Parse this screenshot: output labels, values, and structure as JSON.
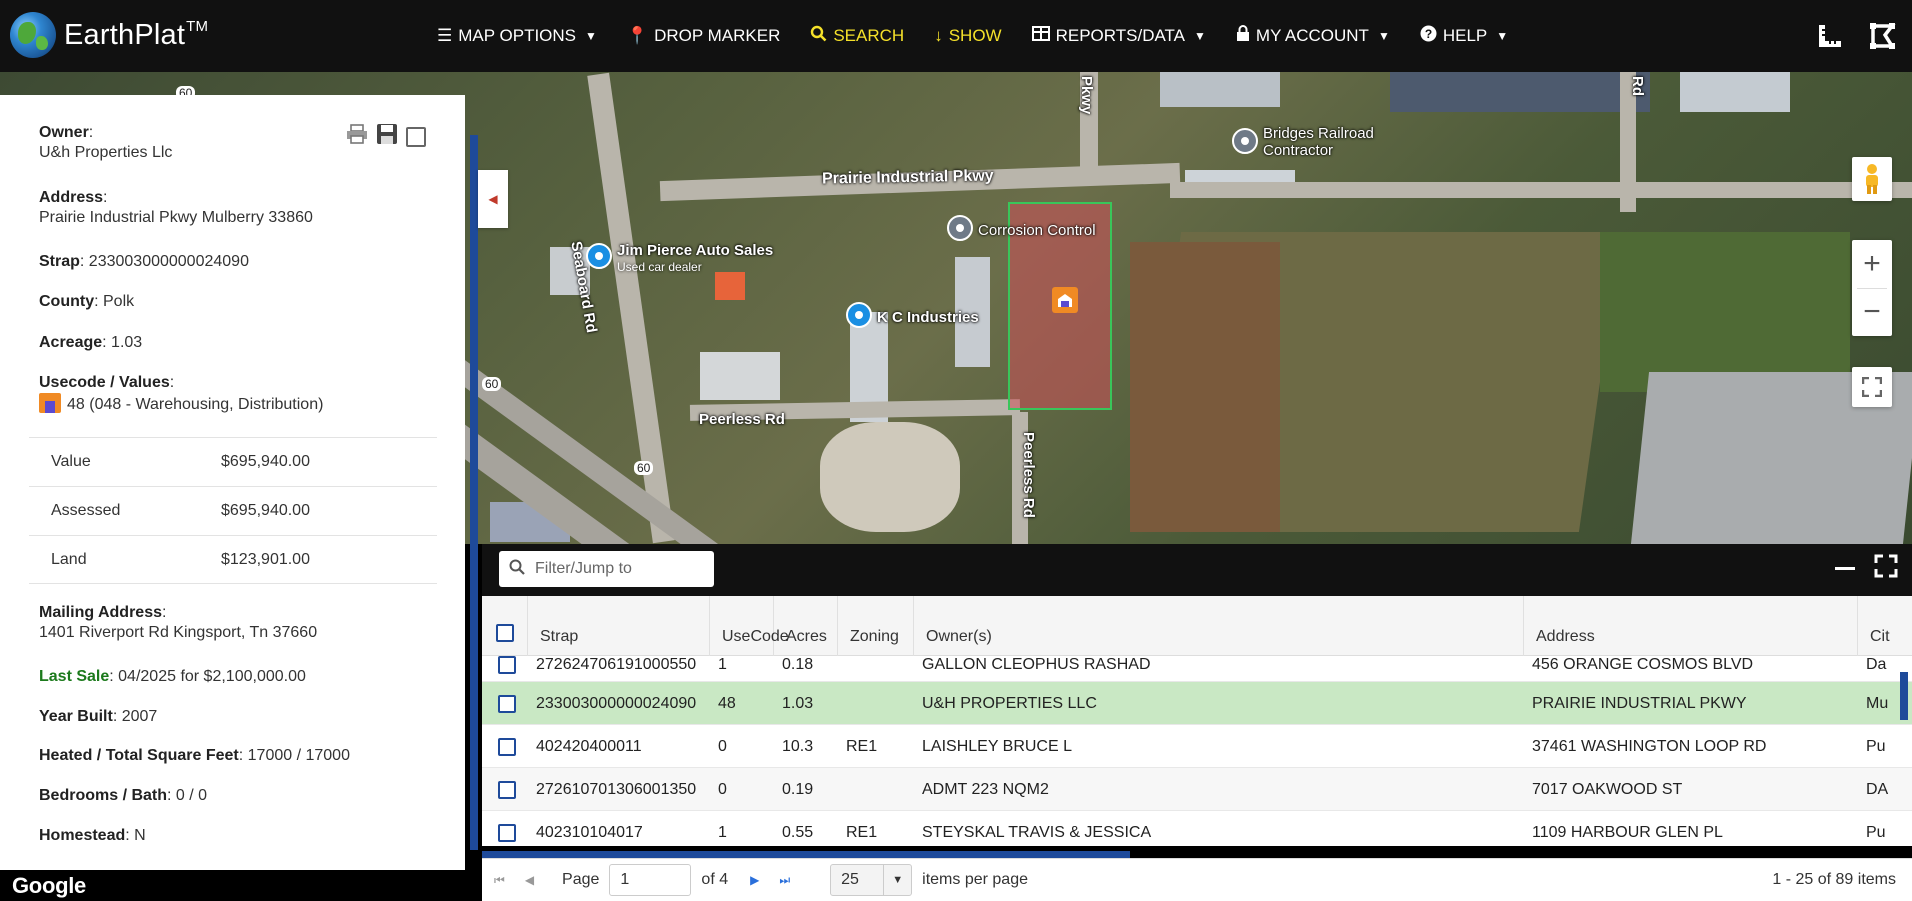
{
  "app": {
    "name": "EarthPlat",
    "trademark": "TM"
  },
  "nav": {
    "map_options": "MAP OPTIONS",
    "drop_marker": "DROP MARKER",
    "search": "SEARCH",
    "show": "SHOW",
    "reports": "REPORTS/DATA",
    "account": "MY ACCOUNT",
    "help": "HELP"
  },
  "map": {
    "labels": {
      "prairie": "Prairie Industrial Pkwy",
      "seaboard": "Seaboard Rd",
      "peerless_h": "Peerless Rd",
      "peerless_v": "Peerless Rd",
      "pkwy": "Pkwy",
      "rd": "Rd",
      "hwy60a": "60",
      "hwy60b": "60",
      "hwy60c": "60"
    },
    "pois": {
      "jim": "Jim Pierce Auto Sales",
      "jim_sub": "Used car dealer",
      "kc": "K C Industries",
      "corrosion": "Corrosion Control",
      "bridges_1": "Bridges Railroad",
      "bridges_2": "Contractor"
    },
    "attribution": "Google"
  },
  "parcel": {
    "owner_label": "Owner",
    "owner": "U&h Properties Llc",
    "address_label": "Address",
    "address": "Prairie Industrial Pkwy Mulberry 33860",
    "strap_label": "Strap",
    "strap": "233003000000024090",
    "county_label": "County",
    "county": "Polk",
    "acreage_label": "Acreage",
    "acreage": "1.03",
    "usecode_label": "Usecode / Values",
    "usecode": "48 (048 - Warehousing, Distribution)",
    "values": [
      {
        "label": "Value",
        "amount": "$695,940.00"
      },
      {
        "label": "Assessed",
        "amount": "$695,940.00"
      },
      {
        "label": "Land",
        "amount": "$123,901.00"
      }
    ],
    "mailing_label": "Mailing Address",
    "mailing": "1401 Riverport Rd Kingsport, Tn 37660",
    "last_sale_label": "Last Sale",
    "last_sale": "04/2025 for $2,100,000.00",
    "year_built_label": "Year Built",
    "year_built": "2007",
    "sqft_label": "Heated / Total Square Feet",
    "sqft": "17000 / 17000",
    "bed_bath_label": "Bedrooms / Bath",
    "bed_bath": "0 / 0",
    "homestead_label": "Homestead",
    "homestead": "N"
  },
  "grid": {
    "filter_placeholder": "Filter/Jump to",
    "columns": [
      "Strap",
      "UseCode",
      "Acres",
      "Zoning",
      "Owner(s)",
      "Address",
      "Cit"
    ],
    "rows": [
      {
        "strap": "272624706191000550",
        "usecode": "1",
        "acres": "0.18",
        "zoning": "",
        "owner": "GALLON CLEOPHUS RASHAD",
        "address": "456 ORANGE COSMOS BLVD",
        "city": "Da"
      },
      {
        "strap": "233003000000024090",
        "usecode": "48",
        "acres": "1.03",
        "zoning": "",
        "owner": "U&H PROPERTIES LLC",
        "address": "PRAIRIE INDUSTRIAL PKWY",
        "city": "Mu"
      },
      {
        "strap": "402420400011",
        "usecode": "0",
        "acres": "10.3",
        "zoning": "RE1",
        "owner": "LAISHLEY BRUCE L",
        "address": "37461 WASHINGTON LOOP RD",
        "city": "Pu"
      },
      {
        "strap": "272610701306001350",
        "usecode": "0",
        "acres": "0.19",
        "zoning": "",
        "owner": "ADMT 223 NQM2",
        "address": "7017 OAKWOOD ST",
        "city": "DA"
      },
      {
        "strap": "402310104017",
        "usecode": "1",
        "acres": "0.55",
        "zoning": "RE1",
        "owner": "STEYSKAL TRAVIS & JESSICA",
        "address": "1109 HARBOUR GLEN PL",
        "city": "Pu"
      }
    ],
    "pager": {
      "page_label": "Page",
      "page": "1",
      "of_label": "of 4",
      "page_size": "25",
      "per_page_label": "items per page",
      "count": "1 - 25 of 89 items"
    }
  }
}
